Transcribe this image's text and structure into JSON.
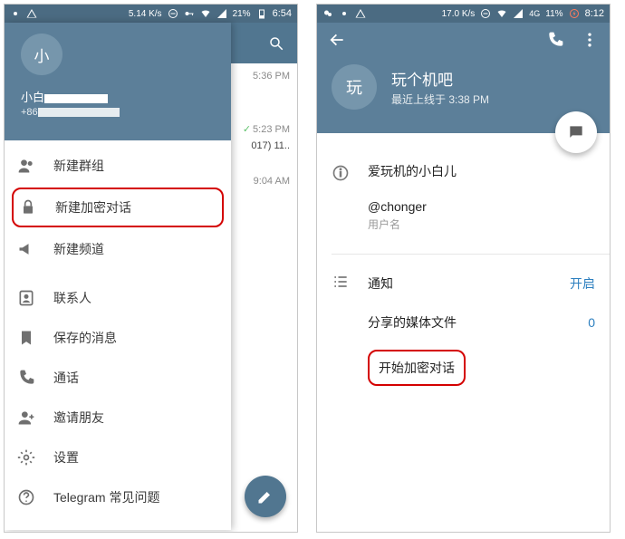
{
  "left": {
    "status": {
      "speed": "5.14 K/s",
      "battery": "21%",
      "time": "6:54"
    },
    "drawer": {
      "avatar_char": "小",
      "name_prefix": "小白",
      "phone_prefix": "+86",
      "items": {
        "new_group": "新建群组",
        "new_secret": "新建加密对话",
        "new_channel": "新建频道",
        "contacts": "联系人",
        "saved": "保存的消息",
        "calls": "通话",
        "invite": "邀请朋友",
        "settings": "设置",
        "faq": "Telegram 常见问题"
      }
    },
    "chat_peek": {
      "r1_time": "5:36 PM",
      "r2_time": "5:23 PM",
      "r2_line2": "017) 11..",
      "r3_time": "9:04 AM"
    }
  },
  "right": {
    "status": {
      "speed": "17.0 K/s",
      "battery": "11%",
      "time": "8:12"
    },
    "profile": {
      "avatar_char": "玩",
      "title": "玩个机吧",
      "subtitle": "最近上线于 3:38 PM"
    },
    "info": {
      "bio": "爱玩机的小白儿",
      "username": "@chonger",
      "username_label": "用户名"
    },
    "settings": {
      "rows": {
        "notif_label": "通知",
        "notif_value": "开启",
        "media_label": "分享的媒体文件",
        "media_value": "0",
        "secret_label": "开始加密对话"
      }
    }
  }
}
